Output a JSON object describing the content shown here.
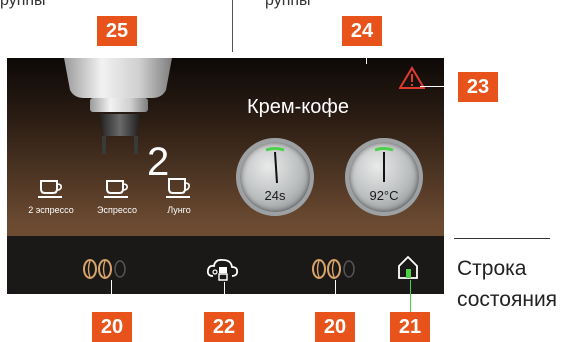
{
  "top_fragments": {
    "left": "руппы",
    "right": "руппы"
  },
  "display": {
    "drink_name": "Крем-кофе",
    "cup_count": "2",
    "cups": [
      {
        "label": "2 эспрессо",
        "icon": "double-cup-icon"
      },
      {
        "label": "Эспрессо",
        "icon": "cup-icon"
      },
      {
        "label": "Лунго",
        "icon": "tall-cup-icon"
      }
    ],
    "gauges": [
      {
        "name": "time-gauge",
        "value": "24s"
      },
      {
        "name": "temperature-gauge",
        "value": "92°C"
      }
    ],
    "warning_icon": "warning-triangle-icon"
  },
  "status_bar": {
    "items": [
      {
        "icon": "bean-strength-icon-left",
        "beans_filled": 2,
        "beans_total": 3
      },
      {
        "icon": "cleaning-icon"
      },
      {
        "icon": "bean-strength-icon-right",
        "beans_filled": 2,
        "beans_total": 3
      },
      {
        "icon": "home-icon"
      }
    ]
  },
  "callouts": {
    "brew_group": "25",
    "drink_area": "24",
    "warning": "23",
    "bean_left": "20",
    "cleaning": "22",
    "bean_right": "20",
    "home": "21"
  },
  "status_bar_label": {
    "line1": "Строка",
    "line2": "состояния"
  },
  "colors": {
    "accent": "#e8531b",
    "screen_dark": "#0d0907",
    "screen_brown": "#7b5638",
    "status_bar": "#1b1918",
    "gauge_green": "#4cd14a",
    "warning_red": "#d83a2e"
  }
}
